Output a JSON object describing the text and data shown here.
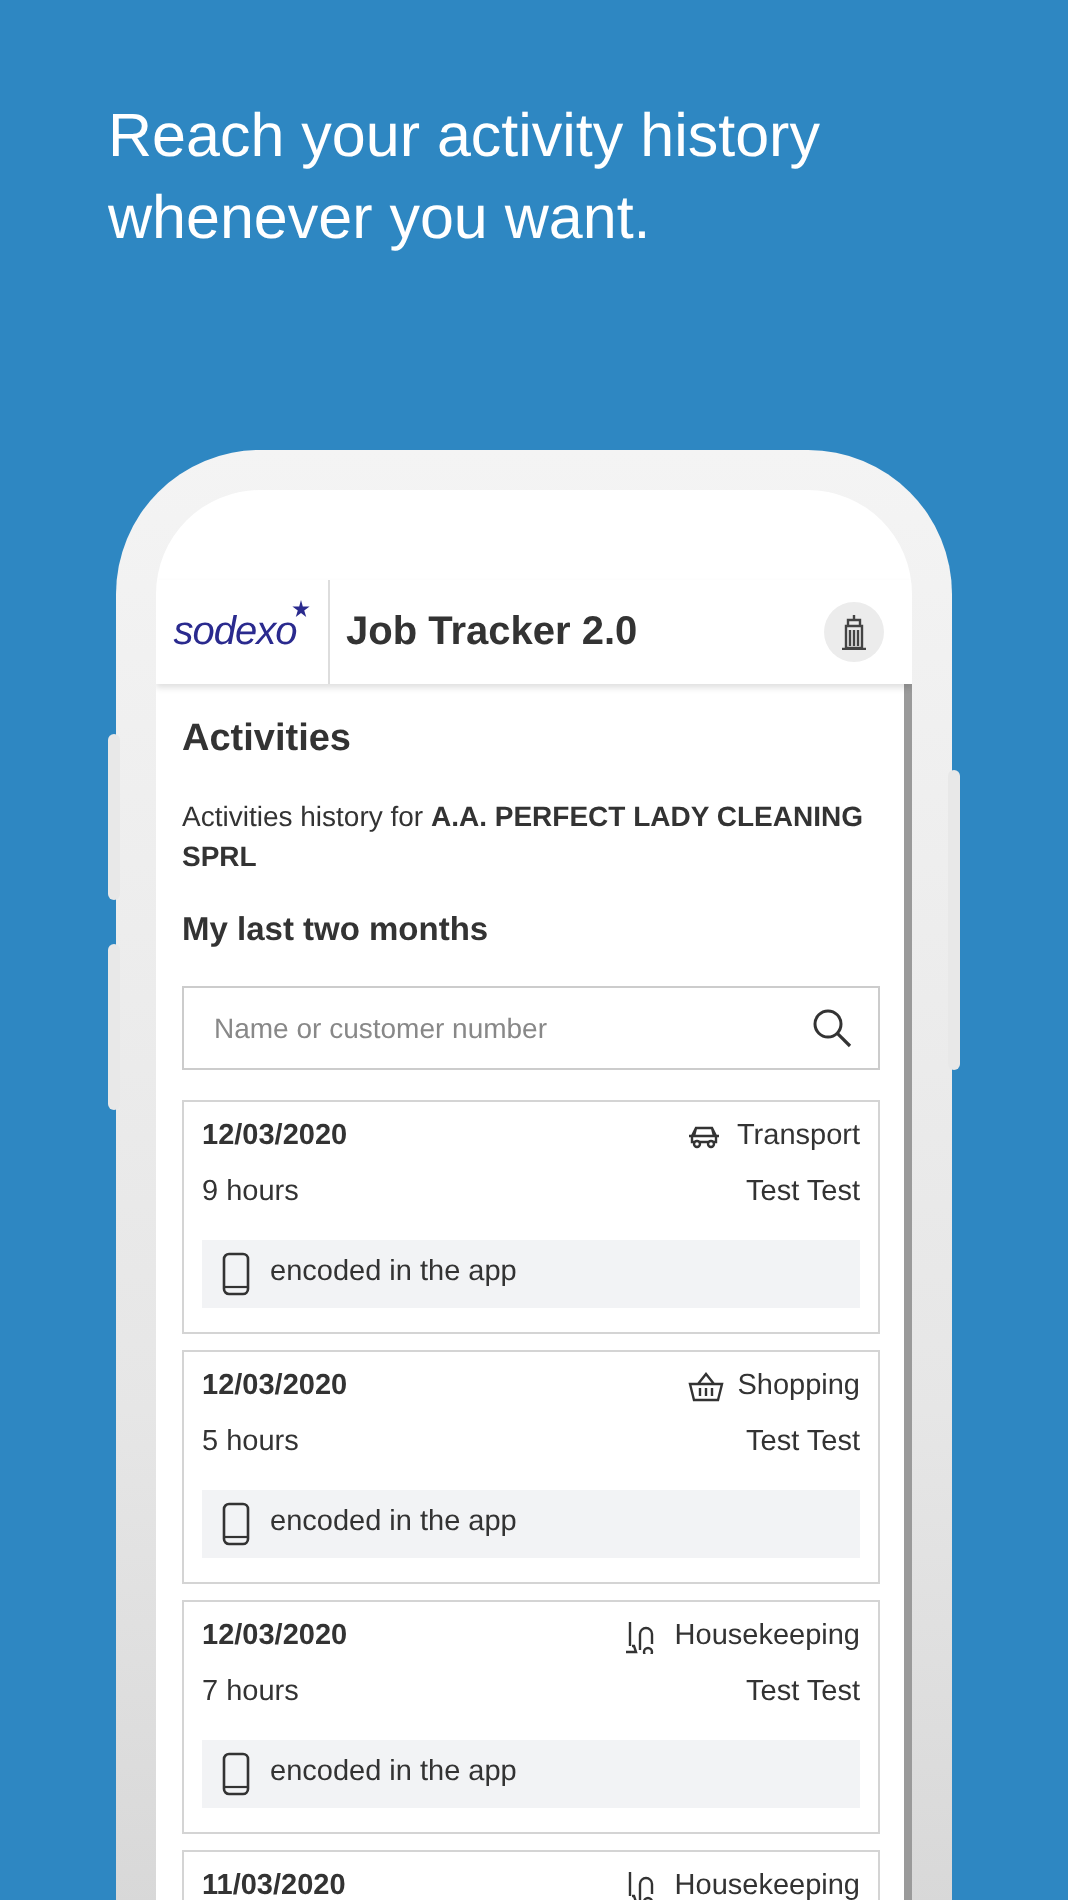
{
  "headline": "Reach your activity history whenever you want.",
  "app": {
    "logo": "sodexo",
    "title": "Job Tracker 2.0"
  },
  "page": {
    "title": "Activities",
    "intro": "Activities history for **A.A. PERFECT LADY CLEANING SPRL**",
    "section": "My last two months"
  },
  "search": {
    "placeholder": "Name or customer number"
  },
  "activities": [
    {
      "date": "12/03/2020",
      "kind": "transport",
      "category": "Transport",
      "hours": "9 hours",
      "person": "Test Test",
      "source": "encoded in the app"
    },
    {
      "date": "12/03/2020",
      "kind": "shopping",
      "category": "Shopping",
      "hours": "5 hours",
      "person": "Test Test",
      "source": "encoded in the app"
    },
    {
      "date": "12/03/2020",
      "kind": "housekeeping",
      "category": "Housekeeping",
      "hours": "7 hours",
      "person": "Test Test",
      "source": "encoded in the app"
    },
    {
      "date": "11/03/2020",
      "kind": "housekeeping",
      "category": "Housekeeping"
    }
  ]
}
